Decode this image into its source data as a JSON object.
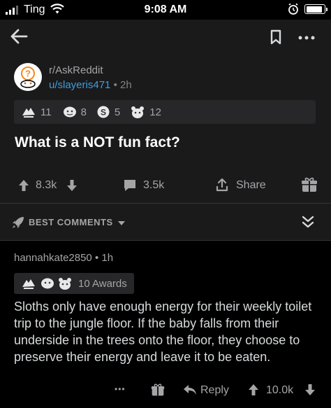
{
  "status_bar": {
    "carrier": "Ting",
    "time": "9:08 AM",
    "signal_bars": 3,
    "battery_level": 0.9
  },
  "post": {
    "subreddit": "r/AskReddit",
    "author": "u/slayeris471",
    "separator": "•",
    "age": "2h",
    "awards": [
      {
        "icon": "award-hands-icon",
        "count": "11"
      },
      {
        "icon": "award-face-icon",
        "count": "8"
      },
      {
        "icon": "award-silver-icon",
        "count": "5"
      },
      {
        "icon": "award-bear-icon",
        "count": "12"
      }
    ],
    "title": "What is a NOT fun fact?",
    "score": "8.3k",
    "comments": "3.5k",
    "share_label": "Share"
  },
  "sort": {
    "label": "BEST COMMENTS"
  },
  "comment": {
    "author": "hannahkate2850",
    "separator": "•",
    "age": "1h",
    "awards_label": "10 Awards",
    "body": "Sloths only have enough energy for their weekly toilet trip to the jungle floor. If the baby falls from their underside in the trees onto the floor, they choose to preserve their energy and leave it to be eaten.",
    "reply_label": "Reply",
    "score": "10.0k",
    "more_label": "•••"
  },
  "colors": {
    "background": "#000000",
    "card": "#1a1a1b",
    "link": "#3d9ee0",
    "muted": "#a5a5a8"
  }
}
